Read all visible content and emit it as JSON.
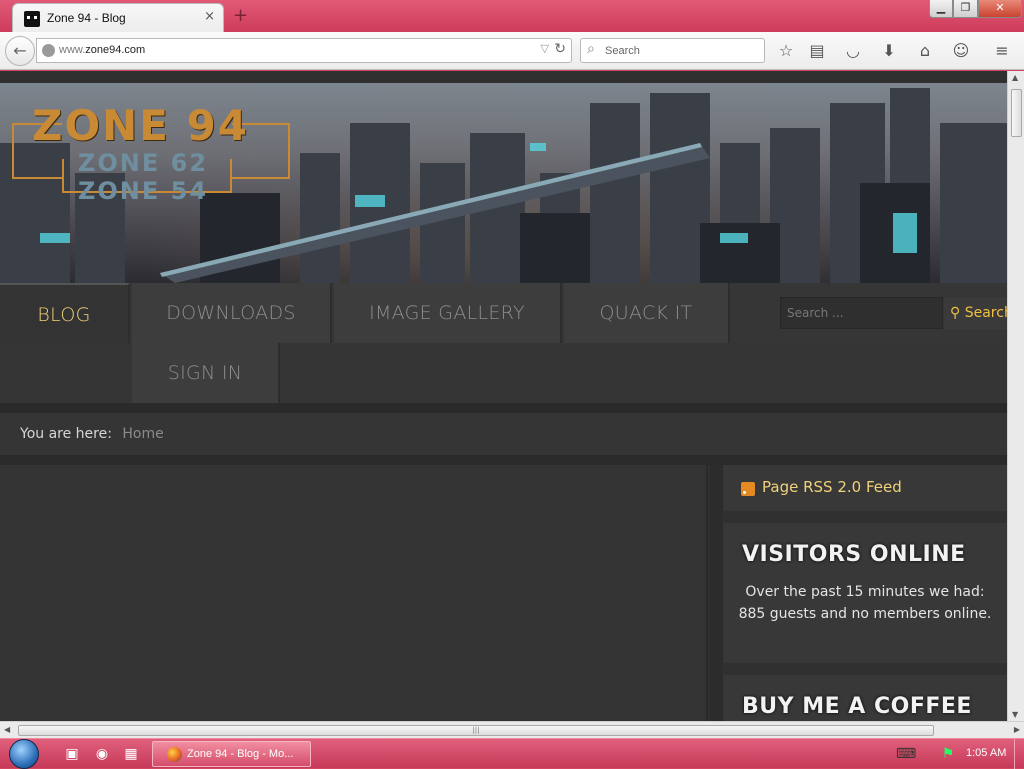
{
  "browser": {
    "tab_title": "Zone 94 - Blog",
    "tab_close": "×",
    "new_tab": "+",
    "window_controls": {
      "minimize": "▁",
      "maximize": "❐",
      "close": "✕"
    },
    "url_prefix": "www.",
    "url_domain": "zone94.com",
    "search_placeholder": "Search",
    "toolbar_icons": [
      "star-icon",
      "reading-list-icon",
      "pocket-icon",
      "download-icon",
      "home-icon",
      "chat-icon",
      "menu-icon"
    ]
  },
  "site": {
    "logo_main": "ZONE 94",
    "logo_sub_1": "ZONE 62",
    "logo_sub_2": "ZONE 54",
    "nav": [
      {
        "label": "BLOG",
        "active": true
      },
      {
        "label": "DOWNLOADS"
      },
      {
        "label": "IMAGE GALLERY"
      },
      {
        "label": "QUACK IT"
      },
      {
        "label": "SIGN IN"
      }
    ],
    "search_placeholder": "Search ...",
    "search_button": "Search",
    "breadcrumb": {
      "prefix": "You are here:",
      "home": "Home"
    },
    "sidebar": {
      "rss_label": "Page RSS 2.0 Feed",
      "visitors_title": "VISITORS ONLINE",
      "visitors_text": "Over the past 15 minutes we had: 885 guests and no members online.",
      "coffee_title": "BUY ME A COFFEE"
    }
  },
  "taskbar": {
    "app_label": "Zone 94 - Blog - Mo...",
    "clock": "1:05 AM"
  },
  "colors": {
    "accent_gold": "#f0d27a",
    "titlebar_pink": "#d6455f",
    "page_dark": "#303030"
  }
}
